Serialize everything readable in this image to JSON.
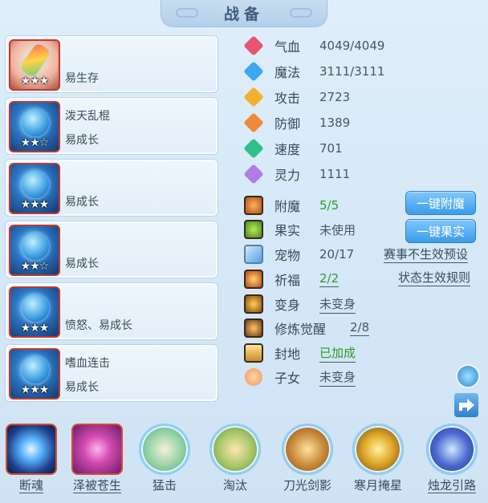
{
  "title": "战备",
  "pets": [
    {
      "name": "",
      "traits": "易生存",
      "stars": "★★★",
      "icon": "ice-popsicle-pet-icon"
    },
    {
      "name": "泼天乱棍",
      "traits": "易成长",
      "stars": "★★☆",
      "icon": "blue-armored-pet-icon"
    },
    {
      "name": "",
      "traits": "易成长",
      "stars": "★★★",
      "icon": "blue-armored-pet-icon"
    },
    {
      "name": "",
      "traits": "易成长",
      "stars": "★★☆",
      "icon": "blue-armored-pet-icon"
    },
    {
      "name": "",
      "traits": "愤怒、易成长",
      "stars": "★★★",
      "icon": "blue-armored-pet-icon"
    },
    {
      "name": "嗜血连击",
      "traits": "易成长",
      "stars": "★★★",
      "icon": "blue-armored-pet-icon"
    }
  ],
  "stats": [
    {
      "label": "气血",
      "value": "4049/4049",
      "icon": "heart-icon",
      "color": "#e8556f"
    },
    {
      "label": "魔法",
      "value": "3111/3111",
      "icon": "mana-icon",
      "color": "#3fa6f0"
    },
    {
      "label": "攻击",
      "value": "2723",
      "icon": "sword-icon",
      "color": "#f3b02a"
    },
    {
      "label": "防御",
      "value": "1389",
      "icon": "shield-icon",
      "color": "#f08a3a"
    },
    {
      "label": "速度",
      "value": "701",
      "icon": "lightning-icon",
      "color": "#2fc08a"
    },
    {
      "label": "灵力",
      "value": "1111",
      "icon": "spirit-icon",
      "color": "#b07de8"
    }
  ],
  "extras": [
    {
      "label": "附魔",
      "value": "5/5",
      "icon": "enchant-icon"
    },
    {
      "label": "果实",
      "value": "未使用",
      "icon": "fruit-icon"
    },
    {
      "label": "宠物",
      "value": "20/17",
      "icon": "pet-icon"
    },
    {
      "label": "祈福",
      "value": "2/2",
      "icon": "blessing-icon"
    },
    {
      "label": "变身",
      "value": "未变身",
      "icon": "transform-icon"
    },
    {
      "label": "修炼觉醒",
      "value": "2/8",
      "icon": "cultivation-icon"
    },
    {
      "label": "封地",
      "value": "已加成",
      "icon": "fief-icon"
    },
    {
      "label": "子女",
      "value": "未变身",
      "icon": "child-icon"
    }
  ],
  "buttons": {
    "enchant": "一键附魔",
    "fruit": "一键果实"
  },
  "links": {
    "preset": "赛事不生效预设",
    "rules": "状态生效规则"
  },
  "skills": [
    {
      "label": "断魂",
      "icon": "soul-break-skill-icon"
    },
    {
      "label": "泽被苍生",
      "icon": "bless-all-skill-icon"
    },
    {
      "label": "猛击",
      "icon": "heavy-strike-skill-icon"
    },
    {
      "label": "淘汰",
      "icon": "eliminate-skill-icon"
    },
    {
      "label": "刀光剑影",
      "icon": "blade-light-skill-icon"
    },
    {
      "label": "寒月掩星",
      "icon": "cold-moon-skill-icon"
    },
    {
      "label": "烛龙引路",
      "icon": "candle-dragon-skill-icon"
    }
  ],
  "colors": {
    "green_value": "#2f9a2a",
    "button_blue": "#3d9be8",
    "frame_red": "#d94a2a"
  }
}
